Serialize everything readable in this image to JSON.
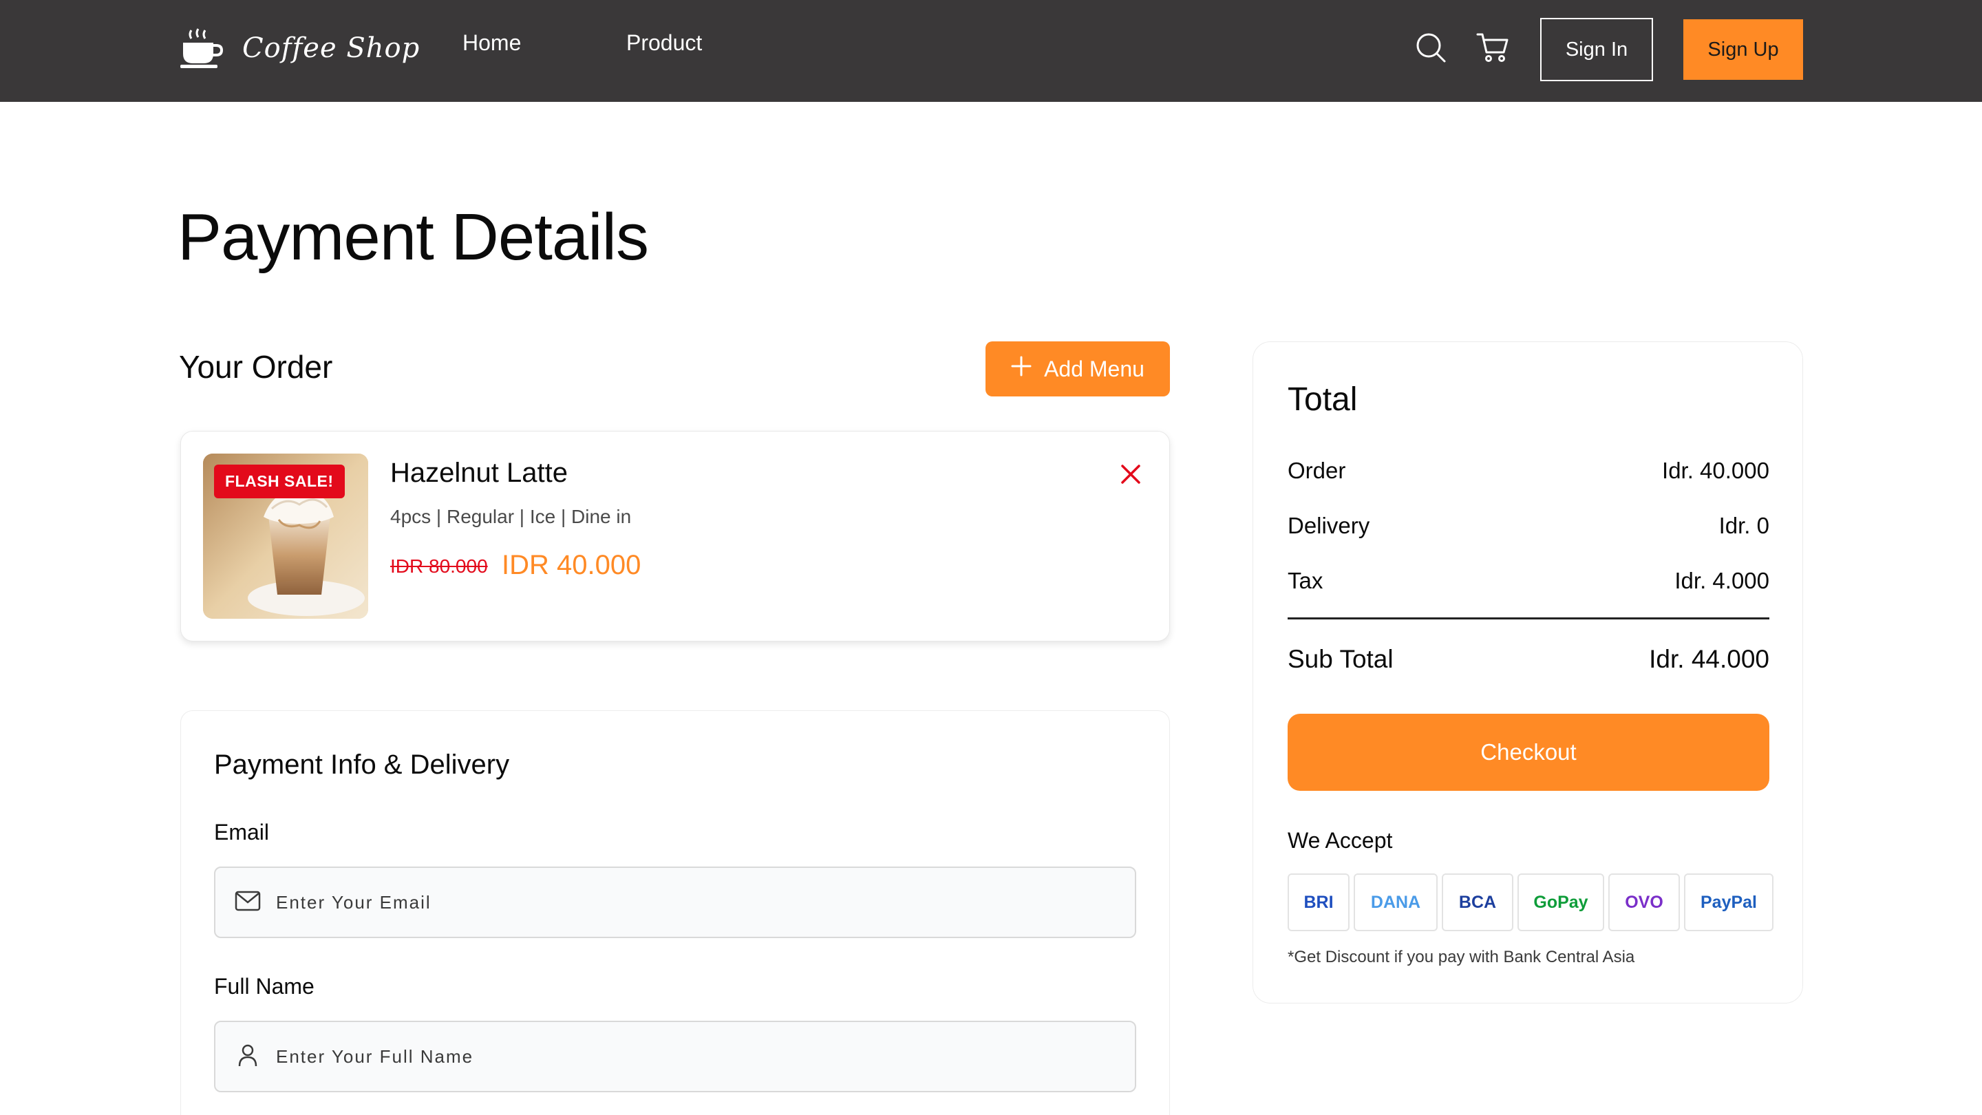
{
  "navbar": {
    "logo_text": "Coffee Shop",
    "logo_icon": "coffee-cup-icon",
    "links": [
      {
        "label": "Home"
      },
      {
        "label": "Product"
      }
    ],
    "search_icon": "search-icon",
    "cart_icon": "cart-icon",
    "sign_in_label": "Sign In",
    "sign_up_label": "Sign Up"
  },
  "page": {
    "title": "Payment Details"
  },
  "order": {
    "section_title": "Your Order",
    "add_menu_label": "Add Menu",
    "item": {
      "badge": "FLASH SALE!",
      "name": "Hazelnut Latte",
      "meta": "4pcs | Regular | Ice | Dine in",
      "old_price": "IDR 80.000",
      "new_price": "IDR 40.000"
    }
  },
  "payment_info": {
    "title": "Payment Info & Delivery",
    "email_label": "Email",
    "email_placeholder": "Enter Your Email",
    "fullname_label": "Full Name",
    "fullname_placeholder": "Enter Your Full Name"
  },
  "total": {
    "title": "Total",
    "rows": [
      {
        "label": "Order",
        "value": "Idr. 40.000"
      },
      {
        "label": "Delivery",
        "value": "Idr. 0"
      },
      {
        "label": "Tax",
        "value": "Idr. 4.000"
      }
    ],
    "subtotal_label": "Sub Total",
    "subtotal_value": "Idr. 44.000",
    "checkout_label": "Checkout",
    "accept_title": "We Accept",
    "methods": [
      {
        "label": "BRI",
        "color": "#1f4fbf"
      },
      {
        "label": "DANA",
        "color": "#4a9be8"
      },
      {
        "label": "BCA",
        "color": "#1d3f9e"
      },
      {
        "label": "GoPay",
        "color": "#0f9d3a"
      },
      {
        "label": "OVO",
        "color": "#7a2fc9"
      },
      {
        "label": "PayPal",
        "color": "#1e5fbf"
      }
    ],
    "note": "*Get Discount if you pay with Bank Central Asia"
  },
  "colors": {
    "accent": "#ff8a25",
    "navbar_bg": "#3a3839",
    "sale_red": "#e30a1b"
  }
}
